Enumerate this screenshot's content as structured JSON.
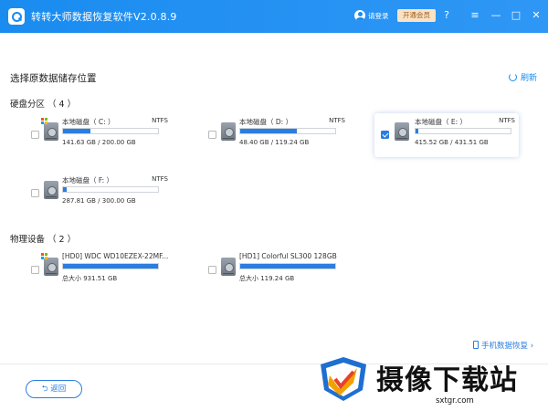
{
  "app": {
    "title": "转转大师数据恢复软件V2.0.8.9",
    "login_label": "请登录",
    "vip_label": "开通会员",
    "icons": [
      "app-logo-icon",
      "user-icon",
      "help-icon",
      "menu-icon",
      "minimize-icon",
      "maximize-icon",
      "close-icon"
    ],
    "window_buttons": {
      "help": "?",
      "menu": "≡",
      "minimize": "—",
      "maximize": "□",
      "close": "✕"
    }
  },
  "main": {
    "title": "选择原数据储存位置",
    "refresh_label": "刷新",
    "partitions": {
      "label": "硬盘分区 （ 4 ）",
      "items": [
        {
          "name": "本地磁盘（ C: ）",
          "fs": "NTFS",
          "size_text": "141.63 GB / 200.00 GB",
          "fill_fraction": 0.29,
          "selected": false,
          "windows_logo": true
        },
        {
          "name": "本地磁盘（ D: ）",
          "fs": "NTFS",
          "size_text": "48.40 GB / 119.24 GB",
          "fill_fraction": 0.6,
          "selected": false,
          "windows_logo": false
        },
        {
          "name": "本地磁盘（ E: ）",
          "fs": "NTFS",
          "size_text": "415.52 GB / 431.51 GB",
          "fill_fraction": 0.03,
          "selected": true,
          "windows_logo": false
        },
        {
          "name": "本地磁盘（ F: ）",
          "fs": "NTFS",
          "size_text": "287.81 GB / 300.00 GB",
          "fill_fraction": 0.04,
          "selected": false,
          "windows_logo": false
        }
      ]
    },
    "physical": {
      "label": "物理设备 （ 2 ）",
      "items": [
        {
          "name": "[HD0] WDC WD10EZEX-22MF...",
          "size_text": "总大小 931.51 GB",
          "fill_fraction": 1.0,
          "selected": false,
          "windows_logo": true
        },
        {
          "name": "[HD1] Colorful SL300 128GB",
          "size_text": "总大小 119.24 GB",
          "fill_fraction": 1.0,
          "selected": false,
          "windows_logo": false
        }
      ]
    }
  },
  "footer": {
    "back_label": "返回",
    "phone_recovery_label": "手机数据恢复 ›"
  },
  "watermark": {
    "text": "摄像下载站",
    "url": "sxtgr.com"
  },
  "colors": {
    "titlebar": "#1a8cf0",
    "accent": "#2a7de1",
    "vip_bg": "#fbe2c4"
  }
}
